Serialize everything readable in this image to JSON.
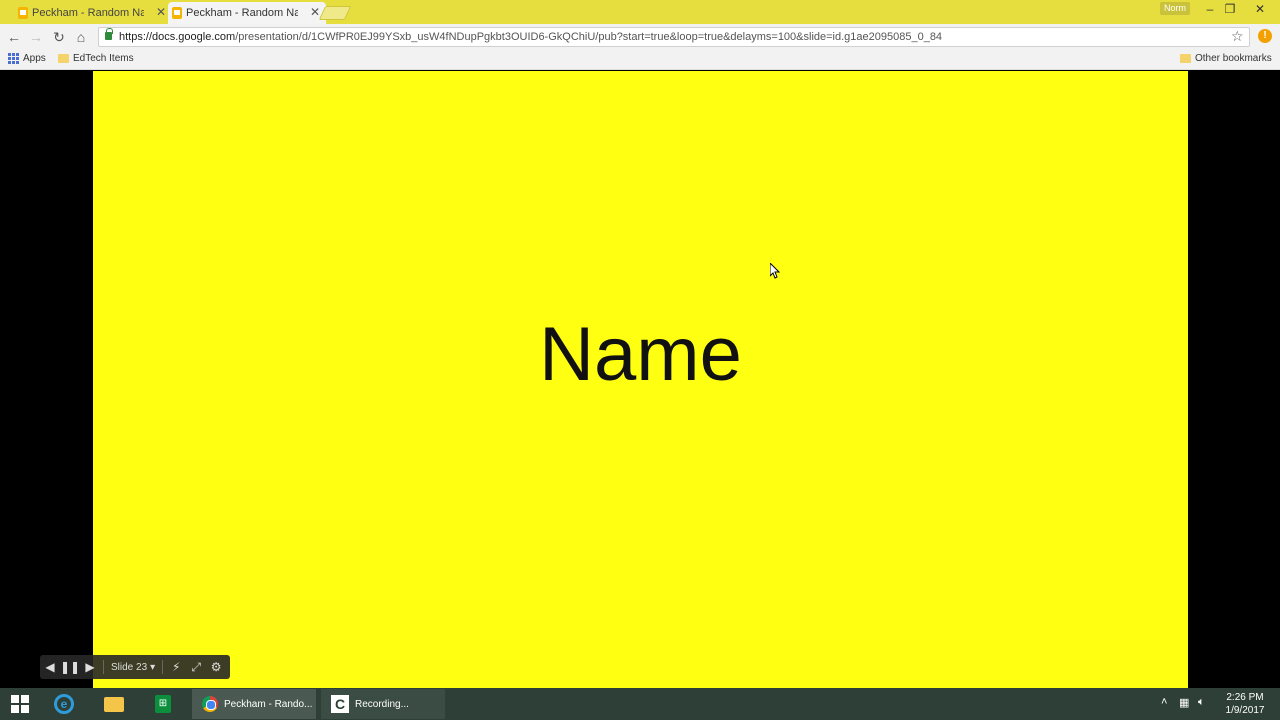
{
  "browser": {
    "tabs": [
      {
        "title": "Peckham - Random Nam",
        "active": false
      },
      {
        "title": "Peckham - Random Nam",
        "active": true
      }
    ],
    "profile_label": "Norm",
    "url_host": "https://docs.google.com",
    "url_path": "/presentation/d/1CWfPR0EJ99YSxb_usW4fNDupPgkbt3OUID6-GkQChiU/pub?start=true&loop=true&delayms=100&slide=id.g1ae2095085_0_84",
    "bookmarks": {
      "apps": "Apps",
      "edtech": "EdTech Items",
      "other": "Other bookmarks"
    }
  },
  "slide": {
    "text": "Name",
    "background_color": "#ffff12"
  },
  "controls": {
    "slide_label": "Slide 23"
  },
  "taskbar": {
    "chrome_app": "Peckham - Rando...",
    "recording_app": "Recording...",
    "time": "2:26 PM",
    "date": "1/9/2017"
  },
  "colors": {
    "tabstrip": "#e6de3f",
    "slide": "#ffff12",
    "taskbar": "#2d3f36"
  }
}
